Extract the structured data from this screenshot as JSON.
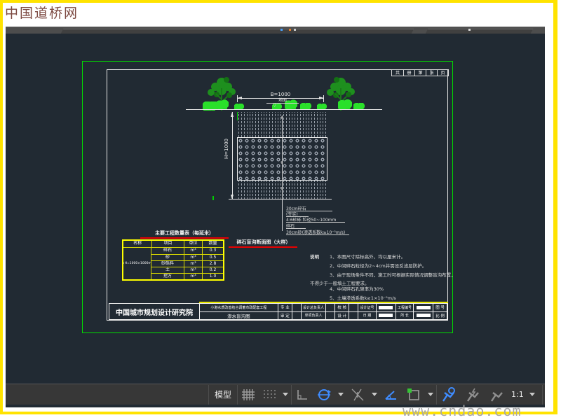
{
  "watermarks": {
    "top": "中国道桥网",
    "bottom": "www.cndao.com"
  },
  "status_bar": {
    "model_label": "模型",
    "scale_label": "1:1",
    "icons": [
      "snap-grid-icon",
      "grid-display-icon",
      "ortho-icon",
      "polar-tracking-icon",
      "osnap-tracking-icon",
      "isometric-angle-icon",
      "object-snap-icon",
      "annotation-visibility-icon",
      "annotation-autoscale-icon",
      "annotation-scale-icon"
    ]
  },
  "drawing": {
    "corner_strip_cells": [
      "共",
      "册",
      "第",
      "张",
      "页"
    ],
    "dims": {
      "width_label": "B=1000",
      "height_label": "H=1000"
    },
    "ground_marker_label": "地面",
    "layer_callouts": [
      "30cm碎石",
      "(夯实)",
      "4:6砂砾 粒径50~100mm",
      "碎石",
      "30cm砂(渗透系数k≥10⁻⁵m/s)"
    ],
    "section_title": "碎石盲沟断面图（大样）",
    "qty_table": {
      "title": "主要工程数量表（每延米）",
      "headers": [
        "名称",
        "项目",
        "单位",
        "数量"
      ],
      "spec": "B×H=1000×1000mm",
      "rows": [
        {
          "item": "碎石",
          "unit": "m³",
          "qty": "0.3"
        },
        {
          "item": "砂",
          "unit": "m³",
          "qty": "0.5"
        },
        {
          "item": "砂砾料",
          "unit": "m³",
          "qty": "2.8"
        },
        {
          "item": "土",
          "unit": "m³",
          "qty": "0.2"
        },
        {
          "item": "挖方",
          "unit": "m³",
          "qty": "1.0"
        }
      ]
    },
    "notes": {
      "label": "说明",
      "lines": [
        "1、本图尺寸除标高外，均以厘米计。",
        "2、中间碎石粒径为2~4cm并需设反滤层防护。",
        "3、由于现场条件不同，施工时可根据实际情况调整盲沟布置，",
        "不得少于一般填土工程要求。",
        "4、中间碎石孔隙率为30%",
        "5、土壤渗透系数k≥1×10⁻⁵m/s"
      ]
    },
    "title_block": {
      "institute": "中国城市规划设计研究院",
      "project": "小港水质改善结合调蓄市政配套工程",
      "drawing_name": "渗水盲沟图",
      "row1_labels": [
        "专 业",
        "设计总负责人",
        "校 核",
        "设计证号",
        "工程编号",
        "图 号"
      ],
      "row2_labels": [
        "审 定",
        "单项负责人",
        "设 计",
        "日 期",
        "所 长",
        "比 例"
      ]
    }
  }
}
